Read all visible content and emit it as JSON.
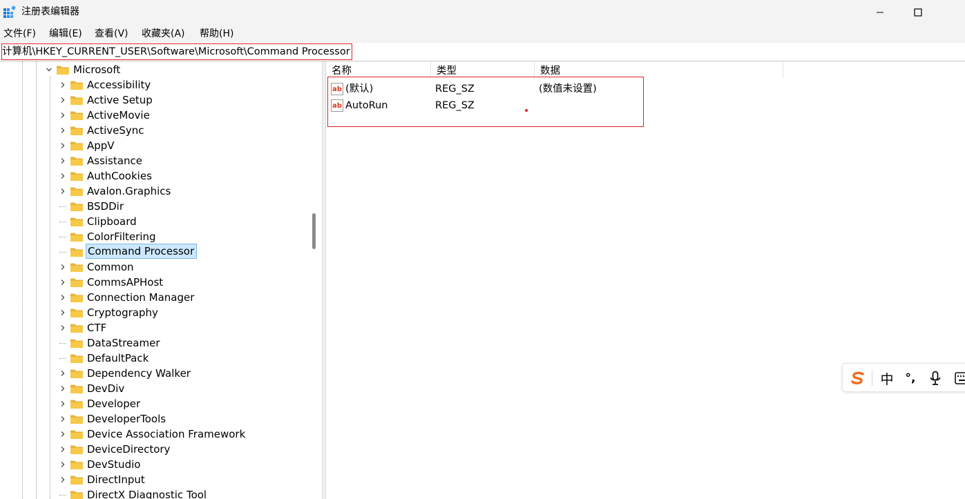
{
  "window": {
    "title": "注册表编辑器"
  },
  "menu": [
    "文件(F)",
    "编辑(E)",
    "查看(V)",
    "收藏夹(A)",
    "帮助(H)"
  ],
  "address": "计算机\\HKEY_CURRENT_USER\\Software\\Microsoft\\Command Processor",
  "tree": {
    "parent": "Microsoft",
    "children": [
      {
        "label": "Accessibility",
        "expandable": true
      },
      {
        "label": "Active Setup",
        "expandable": true
      },
      {
        "label": "ActiveMovie",
        "expandable": true
      },
      {
        "label": "ActiveSync",
        "expandable": true
      },
      {
        "label": "AppV",
        "expandable": true
      },
      {
        "label": "Assistance",
        "expandable": true
      },
      {
        "label": "AuthCookies",
        "expandable": true
      },
      {
        "label": "Avalon.Graphics",
        "expandable": true
      },
      {
        "label": "BSDDir",
        "expandable": false
      },
      {
        "label": "Clipboard",
        "expandable": false
      },
      {
        "label": "ColorFiltering",
        "expandable": false
      },
      {
        "label": "Command Processor",
        "expandable": false,
        "selected": true
      },
      {
        "label": "Common",
        "expandable": true
      },
      {
        "label": "CommsAPHost",
        "expandable": true
      },
      {
        "label": "Connection Manager",
        "expandable": true
      },
      {
        "label": "Cryptography",
        "expandable": true
      },
      {
        "label": "CTF",
        "expandable": true
      },
      {
        "label": "DataStreamer",
        "expandable": false
      },
      {
        "label": "DefaultPack",
        "expandable": false
      },
      {
        "label": "Dependency Walker",
        "expandable": true
      },
      {
        "label": "DevDiv",
        "expandable": true
      },
      {
        "label": "Developer",
        "expandable": true
      },
      {
        "label": "DeveloperTools",
        "expandable": true
      },
      {
        "label": "Device Association Framework",
        "expandable": true
      },
      {
        "label": "DeviceDirectory",
        "expandable": true
      },
      {
        "label": "DevStudio",
        "expandable": true
      },
      {
        "label": "DirectInput",
        "expandable": true
      },
      {
        "label": "DirectX Diagnostic Tool",
        "expandable": false
      }
    ]
  },
  "columns": {
    "name": "名称",
    "type": "类型",
    "data": "数据"
  },
  "values": [
    {
      "name": "(默认)",
      "type": "REG_SZ",
      "data": "(数值未设置)"
    },
    {
      "name": "AutoRun",
      "type": "REG_SZ",
      "data": ""
    }
  ],
  "ime": {
    "mode": "中",
    "punct": "°,"
  },
  "colors": {
    "highlight_border": "#e0202a",
    "selection": "#cce8ff",
    "folder": "#f7c948",
    "ime_logo": "#f26a1b"
  }
}
